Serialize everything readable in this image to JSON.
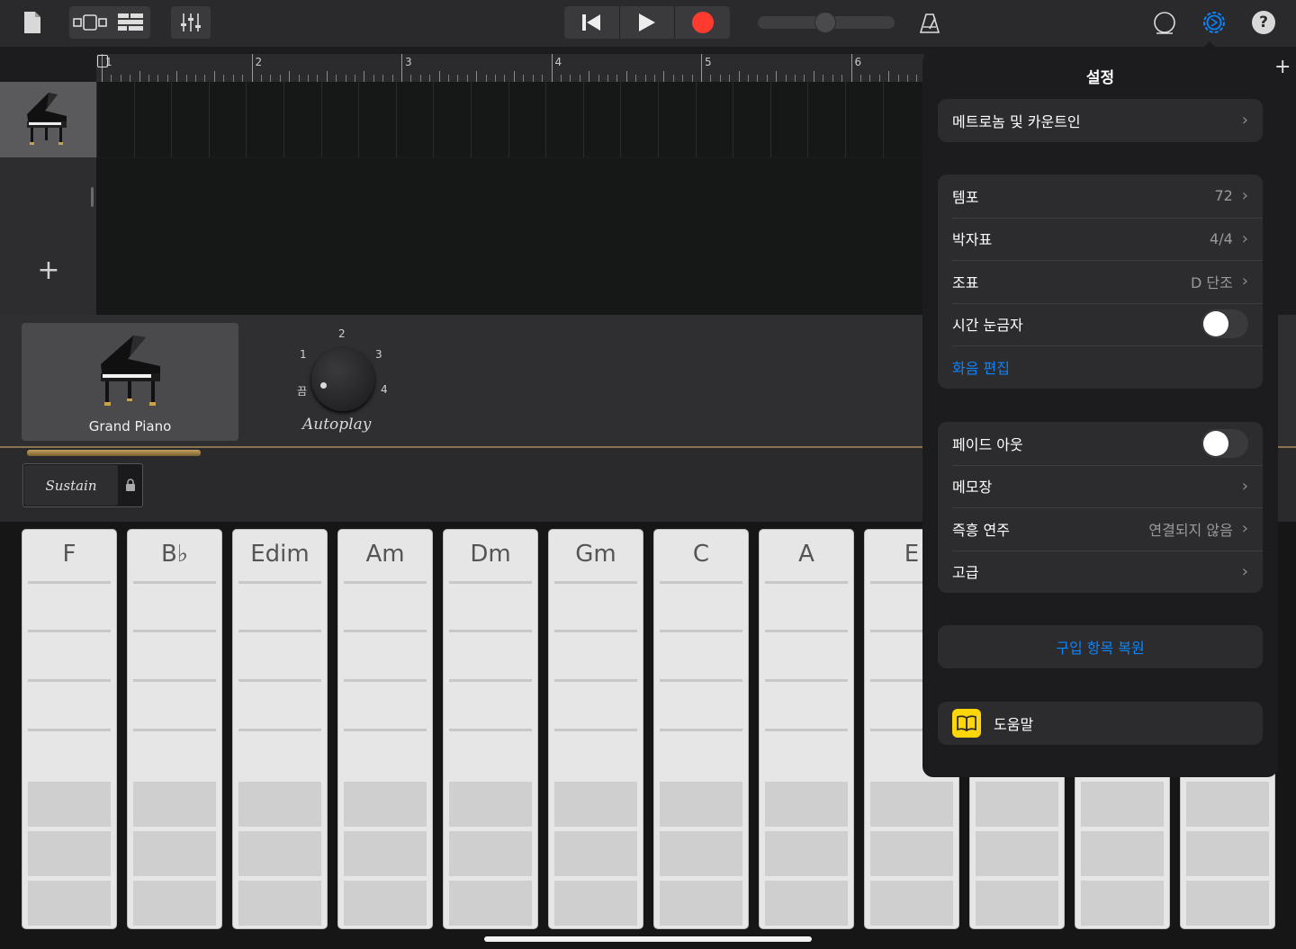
{
  "toolbar": {
    "icons": [
      "document-icon",
      "view-toggle-icon",
      "tracks-view-icon",
      "mixer-icon",
      "rewind-icon",
      "play-icon",
      "record-icon",
      "master-volume-slider",
      "metronome-icon",
      "loop-icon",
      "settings-gear-icon",
      "help-icon"
    ],
    "colors": {
      "record": "#ff3b30",
      "gear": "#0a84ff"
    }
  },
  "ruler": {
    "bars": [
      "1",
      "2",
      "3",
      "4",
      "5",
      "6"
    ]
  },
  "instrument": {
    "name": "Grand Piano",
    "autoplay_label": "Autoplay",
    "autoplay_positions": {
      "off": "끔",
      "p1": "1",
      "p2": "2",
      "p3": "3",
      "p4": "4"
    },
    "sustain_label": "Sustain"
  },
  "chords": [
    "F",
    "B♭",
    "Edim",
    "Am",
    "Dm",
    "Gm",
    "C",
    "A",
    "E",
    "",
    "",
    ""
  ],
  "settings": {
    "title": "설정",
    "metronome": "메트로놈 및 카운트인",
    "tempo_label": "템포",
    "tempo_value": "72",
    "time_sig_label": "박자표",
    "time_sig_value": "4/4",
    "key_label": "조표",
    "key_value": "D 단조",
    "time_ruler_label": "시간 눈금자",
    "time_ruler_on": false,
    "chord_edit": "화음 편집",
    "fade_out_label": "페이드 아웃",
    "fade_out_on": false,
    "notepad": "메모장",
    "jam_label": "즉흥 연주",
    "jam_value": "연결되지 않음",
    "advanced": "고급",
    "restore": "구입 항목 복원",
    "help": "도움말"
  }
}
